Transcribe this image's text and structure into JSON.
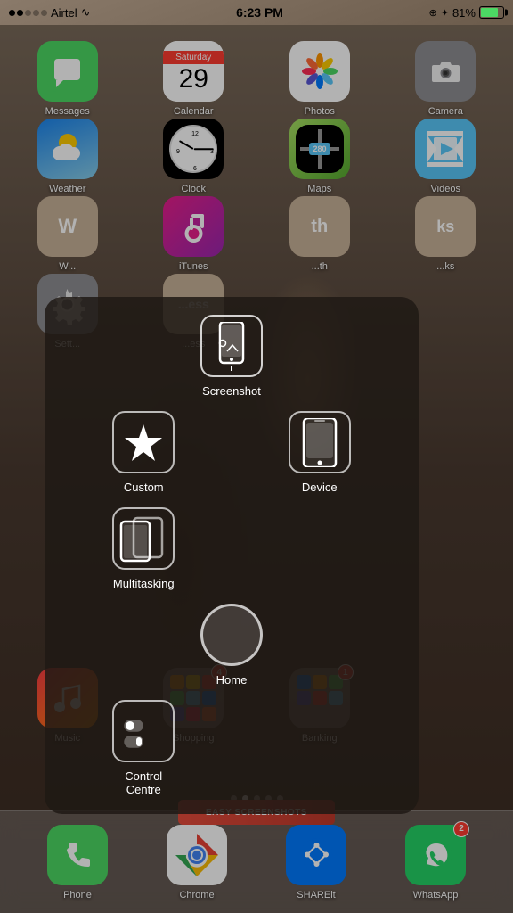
{
  "statusBar": {
    "carrier": "Airtel",
    "time": "6:23 PM",
    "bluetooth": "✦",
    "battery": "81%",
    "batteryFill": 81
  },
  "row1": [
    {
      "id": "messages",
      "label": "Messages",
      "color": "#4cd964",
      "icon": "💬"
    },
    {
      "id": "calendar",
      "label": "Calendar",
      "dayName": "Saturday",
      "dayNum": "29"
    },
    {
      "id": "photos",
      "label": "Photos",
      "icon": "🌸"
    },
    {
      "id": "camera",
      "label": "Camera",
      "color": "#8e8e93"
    }
  ],
  "row2": [
    {
      "id": "weather",
      "label": "Weather",
      "color1": "#1c86ee",
      "color2": "#87ceeb"
    },
    {
      "id": "clock",
      "label": "Clock"
    },
    {
      "id": "maps",
      "label": "Maps"
    },
    {
      "id": "videos",
      "label": "Videos"
    }
  ],
  "row3": [
    {
      "id": "w",
      "label": "W",
      "faded": true
    },
    {
      "id": "itunes",
      "label": "iTunes",
      "color1": "#e91e8c",
      "color2": "#9c27b0"
    },
    {
      "id": "th",
      "label": "th",
      "faded": true
    },
    {
      "id": "ks",
      "label": "ks",
      "faded": true
    }
  ],
  "row4": [
    {
      "id": "settings",
      "label": "Sett...",
      "color": "#8e8e93"
    },
    {
      "id": "ess",
      "label": "...ess",
      "faded": true
    },
    {
      "id": "empty1",
      "label": ""
    },
    {
      "id": "empty2",
      "label": ""
    }
  ],
  "row5": [
    {
      "id": "music",
      "label": "Music"
    },
    {
      "id": "shopping",
      "label": "Shopping",
      "badge": "4"
    },
    {
      "id": "banking",
      "label": "Banking",
      "badge": "1"
    },
    {
      "id": "empty3",
      "label": ""
    }
  ],
  "assistive": {
    "screenshot": {
      "label": "Screenshot"
    },
    "custom": {
      "label": "Custom"
    },
    "device": {
      "label": "Device"
    },
    "multitasking": {
      "label": "Multitasking"
    },
    "home": {
      "label": "Home"
    },
    "controlCentre": {
      "label": "Control Centre"
    }
  },
  "dock": [
    {
      "id": "phone",
      "label": "Phone",
      "color": "#4cd964"
    },
    {
      "id": "chrome",
      "label": "Chrome"
    },
    {
      "id": "shareit",
      "label": "SHAREit"
    },
    {
      "id": "whatsapp",
      "label": "WhatsApp",
      "badge": "2"
    }
  ],
  "pageDots": [
    1,
    2,
    3,
    4,
    5
  ],
  "activePageDot": 2,
  "easyScreenshots": "EASY SCREENSHOTS"
}
